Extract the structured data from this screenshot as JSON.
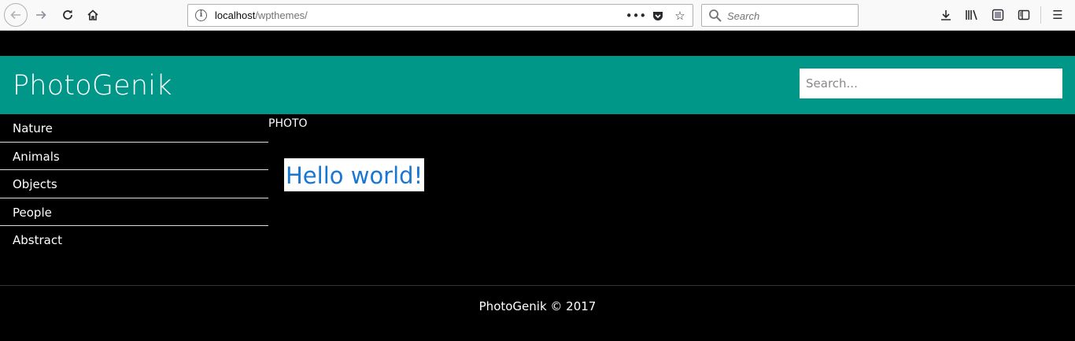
{
  "browser": {
    "url_host": "localhost",
    "url_path": "/wpthemes/",
    "search_placeholder": "Search"
  },
  "site": {
    "title": "PhotoGenik",
    "search_placeholder": "Search..."
  },
  "sidebar": {
    "items": [
      {
        "label": "Nature"
      },
      {
        "label": "Animals"
      },
      {
        "label": "Objects"
      },
      {
        "label": "People"
      },
      {
        "label": "Abstract"
      }
    ]
  },
  "main": {
    "category_label": "PHOTO",
    "post_title": "Hello world!"
  },
  "footer": {
    "text": "PhotoGenik © 2017"
  },
  "colors": {
    "header_bg": "#009688",
    "page_bg": "#000000",
    "link": "#1976d2"
  }
}
